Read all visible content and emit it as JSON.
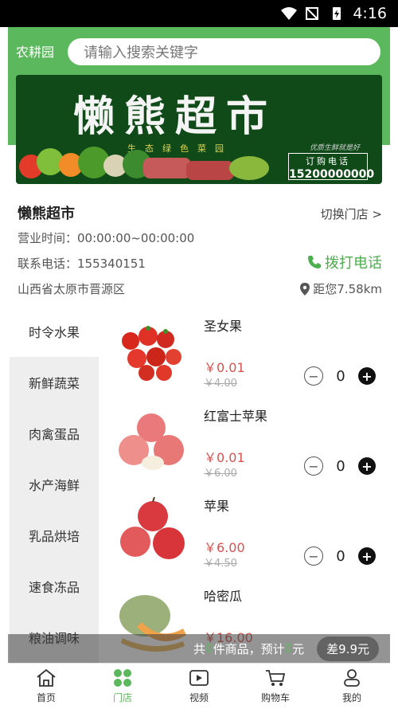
{
  "status_bar": {
    "time": "4:16"
  },
  "header": {
    "location_label": "农耕园",
    "search_placeholder": "请输入搜索关键字"
  },
  "banner": {
    "title": "懒熊超市",
    "slogan": "生态绿色菜园",
    "slogan2": "优质生鲜就是好",
    "order_phone_label": "订购电话",
    "order_phone": "15200000000"
  },
  "store": {
    "name": "懒熊超市",
    "switch_label": "切换门店 >",
    "hours": "营业时间：00:00:00~00:00:00",
    "phone": "联系电话：155340151",
    "call_label": "拨打电话",
    "address": "山西省太原市晋源区",
    "distance": "距您7.58km"
  },
  "categories": [
    {
      "label": "时令水果"
    },
    {
      "label": "新鲜蔬菜"
    },
    {
      "label": "肉禽蛋品"
    },
    {
      "label": "水产海鲜"
    },
    {
      "label": "乳品烘培"
    },
    {
      "label": "速食冻品"
    },
    {
      "label": "粮油调味"
    }
  ],
  "products": [
    {
      "name": "圣女果",
      "price": "￥0.01",
      "old_price": "￥4.00",
      "qty": "0"
    },
    {
      "name": "红富士苹果",
      "price": "￥0.01",
      "old_price": "￥6.00",
      "qty": "0"
    },
    {
      "name": "苹果",
      "price": "￥6.00",
      "old_price": "￥4.50",
      "qty": "0"
    },
    {
      "name": "哈密瓜",
      "price": "￥16.00",
      "old_price": "",
      "qty": "0"
    }
  ],
  "cart_bar": {
    "prefix": "共",
    "count": "0",
    "mid": "件商品，预计",
    "total": "0",
    "suffix": "元",
    "diff": "差9.9元"
  },
  "tabs": [
    {
      "label": "首页",
      "icon": "home-icon"
    },
    {
      "label": "门店",
      "icon": "store-icon"
    },
    {
      "label": "视频",
      "icon": "video-icon"
    },
    {
      "label": "购物车",
      "icon": "cart-icon"
    },
    {
      "label": "我的",
      "icon": "user-icon"
    }
  ],
  "colors": {
    "brand": "#5cb85c",
    "price": "#d9534f",
    "banner_bg": "#0f4a18"
  }
}
